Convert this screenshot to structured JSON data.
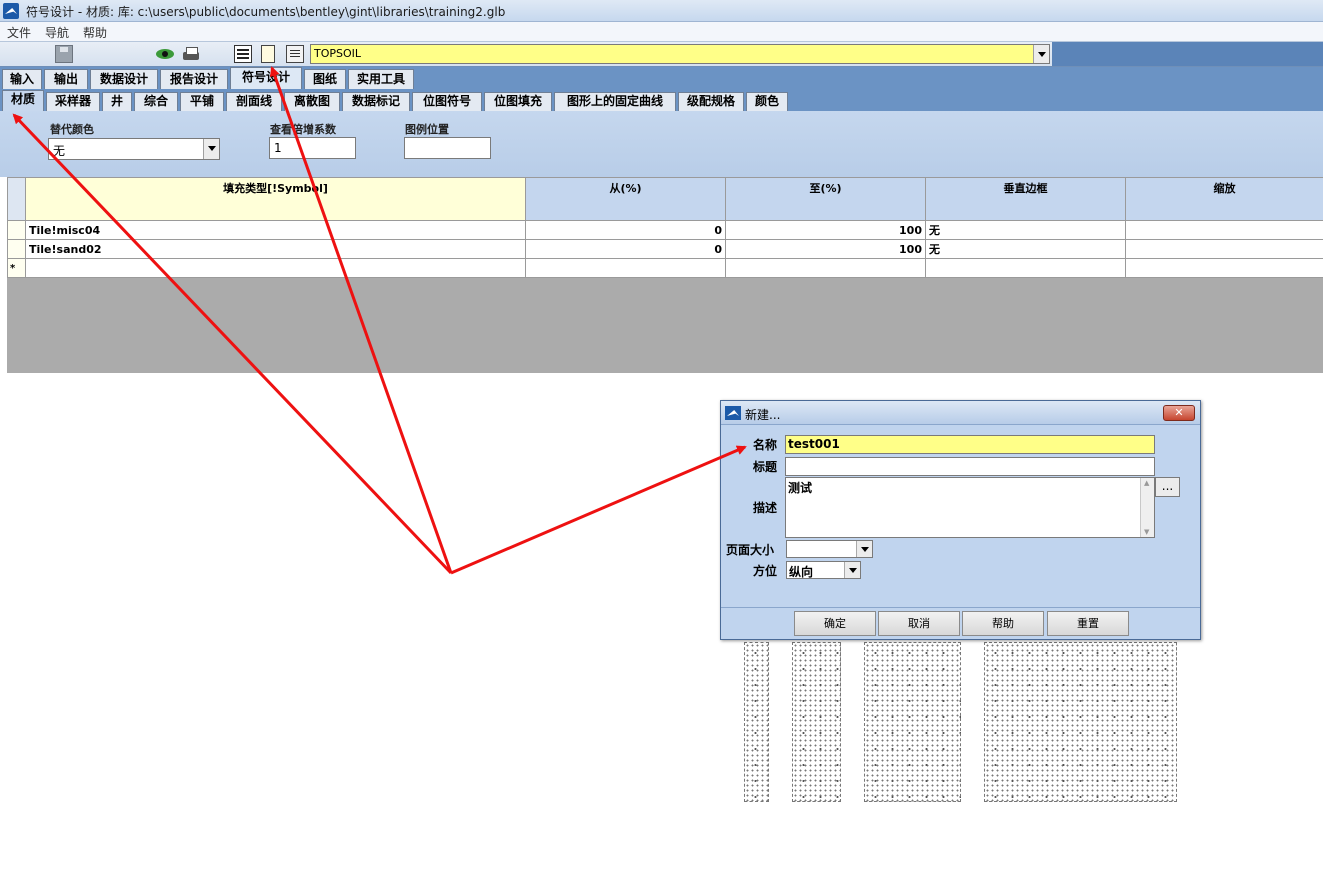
{
  "window": {
    "title": "符号设计 -  材质:  库: c:\\users\\public\\documents\\bentley\\gint\\libraries\\training2.glb"
  },
  "menu": {
    "items": [
      "文件",
      "导航",
      "帮助"
    ]
  },
  "toolbar": {
    "combo_value": "TOPSOIL"
  },
  "main_tabs": [
    "输入",
    "输出",
    "数据设计",
    "报告设计",
    "符号设计",
    "图纸",
    "实用工具"
  ],
  "main_tab_active": "符号设计",
  "sub_tabs": [
    "材质",
    "采样器",
    "井",
    "综合",
    "平铺",
    "剖面线",
    "离散图",
    "数据标记",
    "位图符号",
    "位图填充",
    "图形上的固定曲线",
    "级配规格",
    "颜色"
  ],
  "sub_tab_active": "材质",
  "options": {
    "alt_color_label": "替代颜色",
    "alt_color_value": "无",
    "scale_label": "查看倍增系数",
    "scale_value": "1",
    "legend_label": "图例位置",
    "legend_value": ""
  },
  "grid": {
    "columns": [
      "填充类型[!Symbol]",
      "从(%)",
      "至(%)",
      "垂直边框",
      "缩放"
    ],
    "rows": [
      {
        "marker": "",
        "fill": "Tile!misc04",
        "from": "0",
        "to": "100",
        "border": "无",
        "scale": ""
      },
      {
        "marker": "",
        "fill": "Tile!sand02",
        "from": "0",
        "to": "100",
        "border": "无",
        "scale": ""
      },
      {
        "marker": "*",
        "fill": "",
        "from": "",
        "to": "",
        "border": "",
        "scale": ""
      }
    ]
  },
  "dialog": {
    "title": "新建...",
    "close_label": "✕",
    "name_label": "名称",
    "name_value": "test001",
    "caption_label": "标题",
    "caption_value": "",
    "desc_label": "描述",
    "desc_value": "测试",
    "browse_label": "...",
    "pagesize_label": "页面大小",
    "pagesize_value": "",
    "orient_label": "方位",
    "orient_value": "纵向",
    "buttons": [
      "确定",
      "取消",
      "帮助",
      "重置"
    ]
  },
  "colors": {
    "highlight_yellow": "#ffff88",
    "tab_band": "#6b93c4",
    "annotation_red": "#ee1111"
  }
}
